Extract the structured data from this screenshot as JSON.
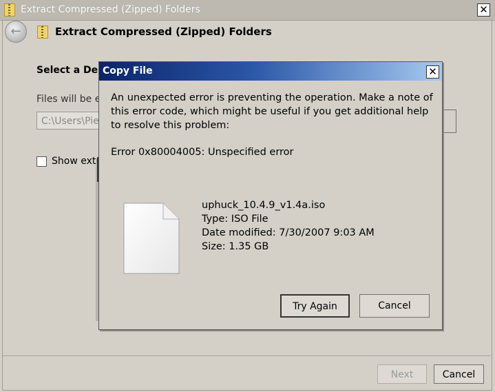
{
  "outer_window": {
    "title": "Extract Compressed (Zipped) Folders",
    "header": "Extract Compressed (Zipped) Folders",
    "close_glyph": "✕",
    "back_glyph": "←",
    "heading_partial": "Select a Desti",
    "files_label_partial": "Files will be e",
    "path_value_partial": "C:\\Users\\Pier",
    "checkbox_label_partial": "Show extr",
    "next_label": "Next",
    "cancel_label": "Cancel"
  },
  "dialog": {
    "title": "Copy File",
    "close_glyph": "✕",
    "message": "An unexpected error is preventing the operation. Make a note of this error code, which might be useful if you get additional help to resolve this problem:",
    "error": "Error 0x80004005: Unspecified error",
    "file": {
      "name": "uphuck_10.4.9_v1.4a.iso",
      "type": "Type: ISO File",
      "date": "Date modified: 7/30/2007 9:03 AM",
      "size": "Size: 1.35 GB",
      "icon": "file-icon"
    },
    "try_again_label": "Try Again",
    "cancel_label": "Cancel"
  },
  "colors": {
    "dialog_title_start": "#0b246a",
    "dialog_title_end": "#a6caf0",
    "window_bg": "#d4d0c8"
  }
}
